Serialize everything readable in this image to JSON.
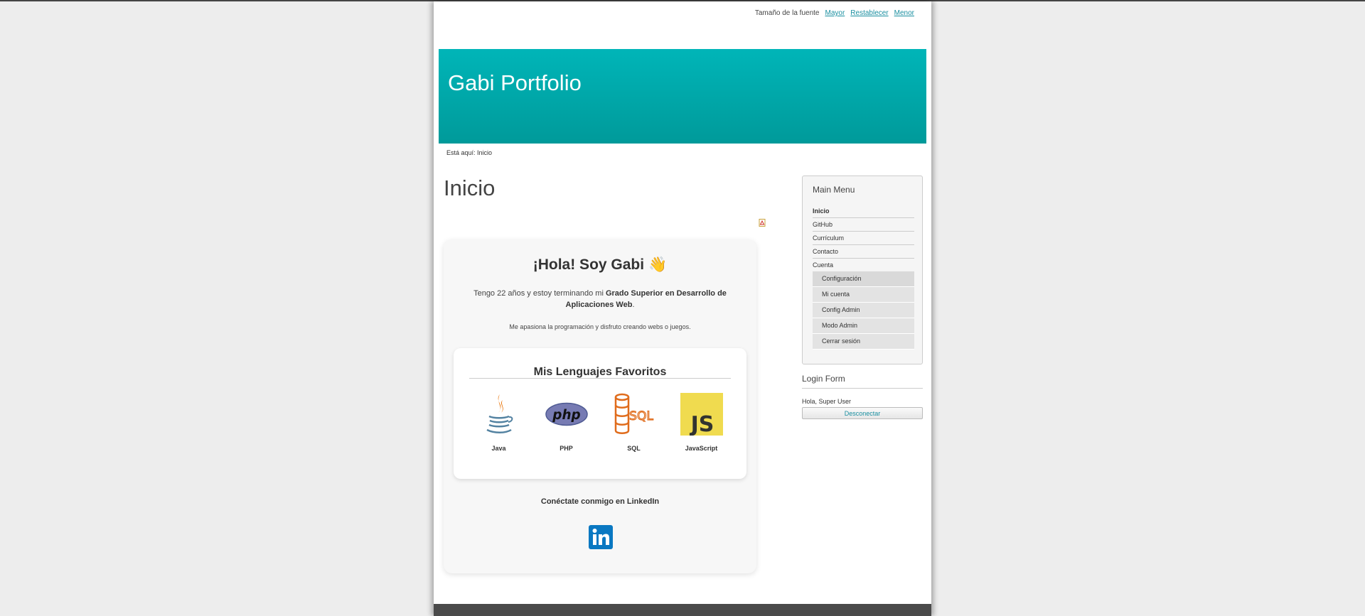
{
  "font_size": {
    "label": "Tamaño de la fuente",
    "bigger": "Mayor",
    "reset": "Restablecer",
    "smaller": "Menor"
  },
  "site": {
    "title": "Gabi Portfolio"
  },
  "breadcrumb": "Está aquí: Inicio",
  "page": {
    "title": "Inicio"
  },
  "card": {
    "heading": "¡Hola! Soy Gabi",
    "wave_emoji": "👋",
    "intro_pre": "Tengo 22 años y estoy terminando mi ",
    "intro_bold": "Grado Superior en Desarrollo de Aplicaciones Web",
    "intro_post": ".",
    "passion": "Me apasiona la programación y disfruto creando webs o juegos.",
    "languages_title": "Mis Lenguajes Favoritos",
    "languages": [
      {
        "name": "Java",
        "icon": "java-icon"
      },
      {
        "name": "PHP",
        "icon": "php-icon"
      },
      {
        "name": "SQL",
        "icon": "sql-icon"
      },
      {
        "name": "JavaScript",
        "icon": "javascript-icon"
      }
    ],
    "connect": "Conéctate conmigo en LinkedIn",
    "linkedin_icon": "linkedin-icon"
  },
  "main_menu": {
    "title": "Main Menu",
    "items": [
      "Inicio",
      "GitHub",
      "Currículum",
      "Contacto",
      "Cuenta"
    ],
    "sub_items": [
      "Configuración",
      "Mi cuenta",
      "Config Admin",
      "Modo Admin",
      "Cerrar sesión"
    ]
  },
  "login": {
    "title": "Login Form",
    "greeting": "Hola, Super User",
    "logout": "Desconectar"
  },
  "colors": {
    "header_top": "#00b5b8",
    "header_bottom": "#009a9a",
    "link": "#1a8fa0",
    "footer": "#4a4a4a"
  }
}
